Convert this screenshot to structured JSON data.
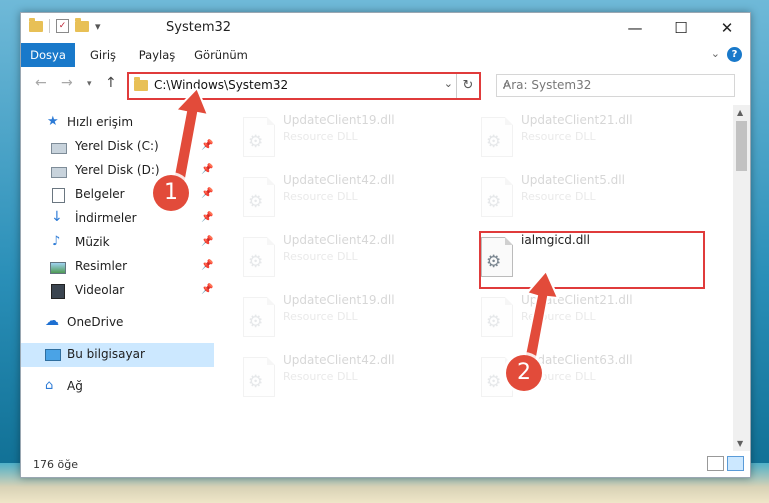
{
  "window": {
    "title": "System32",
    "ribbon_tabs": [
      {
        "label": "Dosya",
        "active": true
      },
      {
        "label": "Giriş",
        "active": false
      },
      {
        "label": "Paylaş",
        "active": false
      },
      {
        "label": "Görünüm",
        "active": false
      }
    ],
    "address": "C:\\Windows\\System32",
    "search_placeholder": "Ara: System32",
    "item_count": "176 öğe"
  },
  "sidebar": {
    "quick_access": "Hızlı erişim",
    "items": [
      {
        "label": "Yerel Disk (C:)",
        "icon": "drive-icon",
        "pinned": true
      },
      {
        "label": "Yerel Disk (D:)",
        "icon": "drive-icon",
        "pinned": true
      },
      {
        "label": "Belgeler",
        "icon": "documents-icon",
        "pinned": true
      },
      {
        "label": "İndirmeler",
        "icon": "download-icon",
        "pinned": true
      },
      {
        "label": "Müzik",
        "icon": "music-icon",
        "pinned": true
      },
      {
        "label": "Resimler",
        "icon": "pictures-icon",
        "pinned": true
      },
      {
        "label": "Videolar",
        "icon": "videos-icon",
        "pinned": true
      }
    ],
    "onedrive": "OneDrive",
    "this_pc": "Bu bilgisayar",
    "network": "Ağ"
  },
  "files": [
    {
      "name": "UpdateClient19.dll",
      "type": "Resource DLL",
      "highlight": false
    },
    {
      "name": "UpdateClient21.dll",
      "type": "Resource DLL",
      "highlight": false
    },
    {
      "name": "UpdateClient42.dll",
      "type": "Resource DLL",
      "highlight": false
    },
    {
      "name": "UpdateClient5.dll",
      "type": "Resource DLL",
      "highlight": false
    },
    {
      "name": "UpdateClient42.dll",
      "type": "Resource DLL",
      "highlight": false
    },
    {
      "name": "ialmgicd.dll",
      "type": "",
      "highlight": true
    },
    {
      "name": "UpdateClient19.dll",
      "type": "Resource DLL",
      "highlight": false
    },
    {
      "name": "UpdateClient21.dll",
      "type": "Resource DLL",
      "highlight": false
    },
    {
      "name": "UpdateClient42.dll",
      "type": "Resource DLL",
      "highlight": false
    },
    {
      "name": "UpdateClient63.dll",
      "type": "Resource DLL",
      "highlight": false
    }
  ],
  "callouts": [
    "1",
    "2"
  ],
  "colors": {
    "accent": "#1979ca",
    "highlight": "#e03b3b",
    "callout": "#e24b3a",
    "selection": "#cce8ff"
  }
}
